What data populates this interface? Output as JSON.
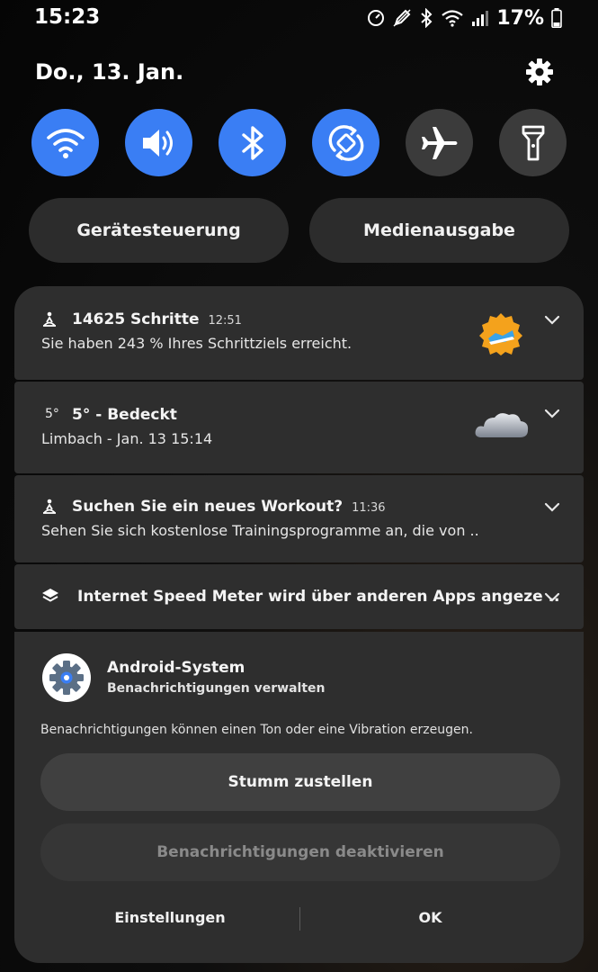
{
  "status_bar": {
    "time": "15:23",
    "battery": "17%",
    "icons": [
      "speed-meter-icon",
      "edit-icon",
      "bluetooth-icon",
      "wifi-icon",
      "signal-icon",
      "battery-icon"
    ]
  },
  "header": {
    "date": "Do., 13. Jan.",
    "settings_icon": "gear-icon"
  },
  "quick_toggles": [
    {
      "name": "wifi",
      "icon": "wifi-icon",
      "state": "on"
    },
    {
      "name": "sound",
      "icon": "speaker-icon",
      "state": "on"
    },
    {
      "name": "bluetooth",
      "icon": "bluetooth-icon",
      "state": "on"
    },
    {
      "name": "auto-rotate",
      "icon": "rotate-icon",
      "state": "on"
    },
    {
      "name": "airplane",
      "icon": "airplane-icon",
      "state": "off"
    },
    {
      "name": "flashlight",
      "icon": "flashlight-icon",
      "state": "off"
    }
  ],
  "buttons": {
    "device_control": "Gerätesteuerung",
    "media_output": "Medienausgabe"
  },
  "notifications": [
    {
      "icon": "fitness-icon",
      "title": "14625 Schritte",
      "time": "12:51",
      "body": "Sie haben 243 % Ihres Schrittziels erreicht.",
      "image": "shoe-badge-icon"
    },
    {
      "icon_text": "5°",
      "title": "5° -  Bedeckt",
      "body": "Limbach - Jan. 13  15:14",
      "image": "cloud-icon"
    },
    {
      "icon": "fitness-icon",
      "title": "Suchen Sie ein neues Workout?",
      "time": "11:36",
      "body": "Sehen Sie sich kostenlose Trainingsprogramme an, die von .."
    },
    {
      "icon": "layers-icon",
      "title": "Internet Speed Meter wird über anderen Apps angeze .."
    }
  ],
  "system_panel": {
    "app_name": "Android-System",
    "subtitle": "Benachrichtigungen verwalten",
    "description": "Benachrichtigungen können einen Ton oder eine Vibration erzeugen.",
    "mute_button": "Stumm zustellen",
    "disable_button": "Benachrichtigungen deaktivieren",
    "settings_link": "Einstellungen",
    "ok_button": "OK"
  },
  "colors": {
    "accent": "#3a7ef4",
    "toggle_off": "#3b3b3b",
    "card": "#2e2e2e",
    "disabled_text": "#8a8a8a"
  }
}
